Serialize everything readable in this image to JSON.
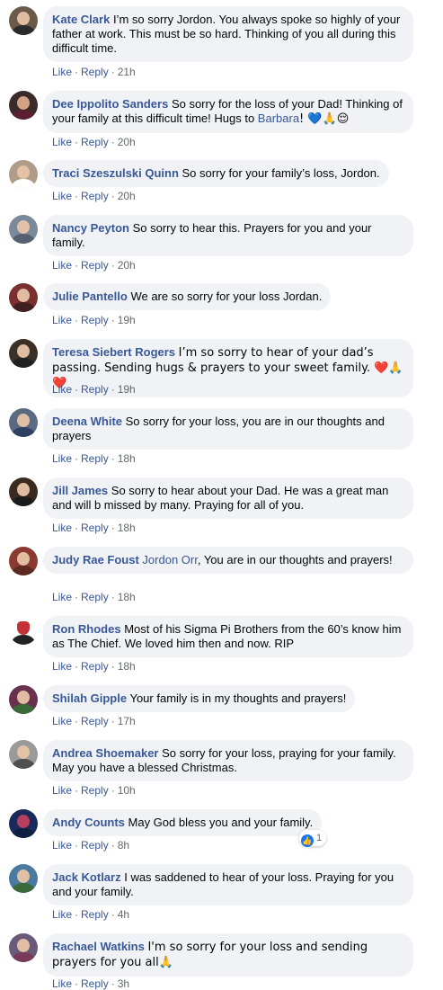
{
  "like_label": "Like",
  "reply_label": "Reply",
  "comments": [
    {
      "author": "Kate Clark",
      "text": "I’m so sorry Jordon. You always spoke so highly of your father at work. This must be so hard. Thinking of you all during this difficult time.",
      "time": "21h"
    },
    {
      "author": "Dee Ippolito Sanders",
      "text": "So sorry for the loss of your Dad! Thinking of your family at this difficult time! Hugs to ",
      "mention": "Barbara",
      "text_after": "! 💙🙏😌",
      "time": "20h"
    },
    {
      "author": "Traci Szeszulski Quinn",
      "text": "So sorry for your family’s loss, Jordon.",
      "time": "20h"
    },
    {
      "author": "Nancy Peyton",
      "text": "So sorry to hear this. Prayers for you and your family.",
      "time": "20h"
    },
    {
      "author": "Julie Pantello",
      "text": "We are so sorry for your loss Jordan.",
      "time": "19h"
    },
    {
      "author": "Teresa Siebert Rogers",
      "text": "I’m so sorry to hear of your dad’s passing. Sending hugs & prayers to your sweet family. ❤️🙏❤️",
      "time": "19h"
    },
    {
      "author": "Deena White",
      "text": "So sorry for your loss, you are in our thoughts and prayers",
      "time": "18h"
    },
    {
      "author": "Jill James",
      "text": "So sorry to hear about your Dad. He was a great man and will b missed by many. Praying for all of you.",
      "time": "18h"
    },
    {
      "author": "Judy Rae Foust",
      "mention": "Jordon Orr",
      "text_after": ", You are in our thoughts and prayers!",
      "time": "18h"
    },
    {
      "author": "Ron Rhodes",
      "text": "Most of his Sigma Pi Brothers from the 60’s know him as The Chief. We loved him then and now. RIP",
      "time": "18h"
    },
    {
      "author": "Shilah Gipple",
      "text": "Your family is in my thoughts and prayers!",
      "time": "17h"
    },
    {
      "author": "Andrea Shoemaker",
      "text": "So sorry for your loss, praying for your family. May you have a blessed Christmas.",
      "time": "10h"
    },
    {
      "author": "Andy Counts",
      "text": "May God bless you and your family.",
      "time": "8h",
      "reaction_count": "1"
    },
    {
      "author": "Jack Kotlarz",
      "text": "I was saddened to hear of your loss. Praying for you and your family.",
      "time": "4h"
    },
    {
      "author": "Rachael Watkins",
      "text": "I'm so sorry for your loss and sending prayers for you all🙏",
      "time": "3h"
    }
  ]
}
